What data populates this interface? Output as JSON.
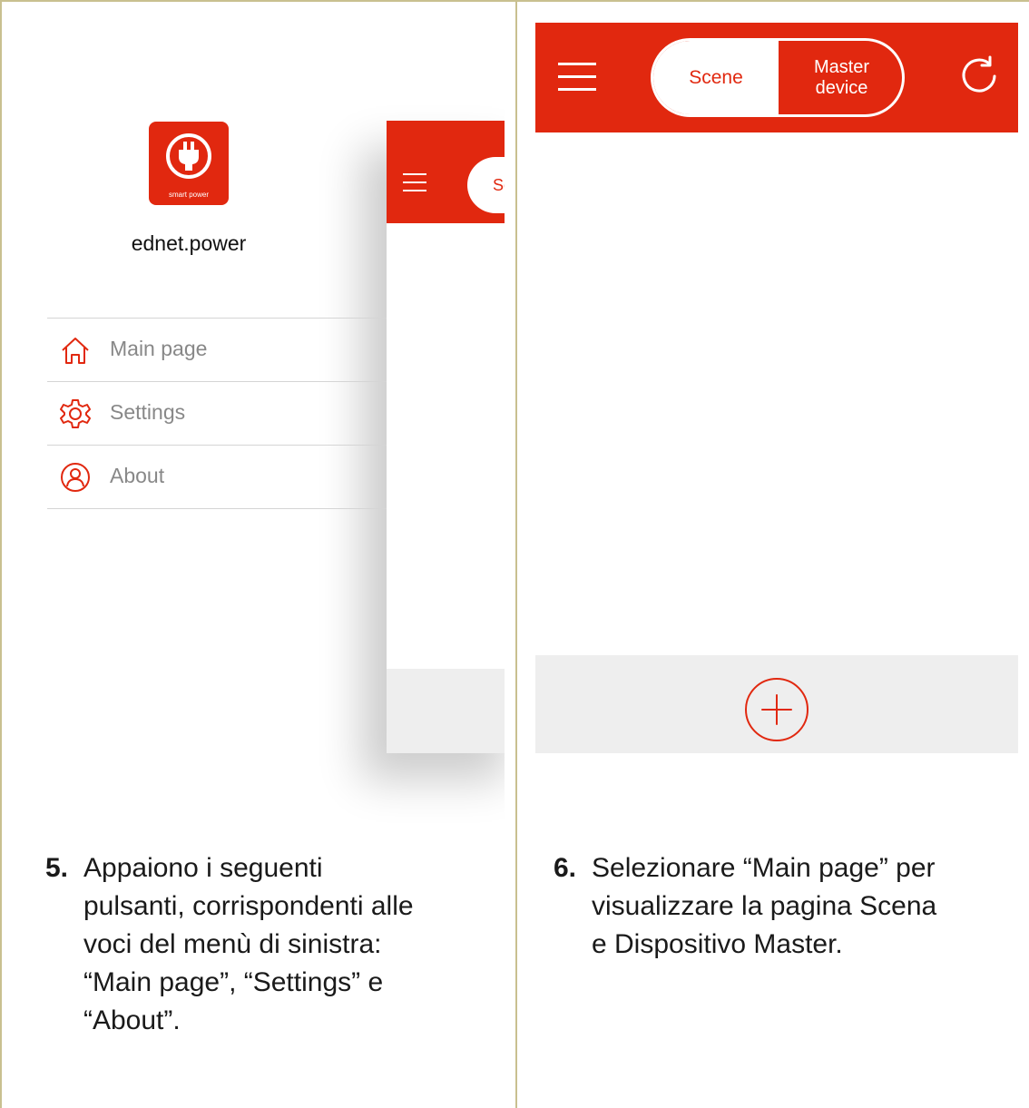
{
  "left_panel": {
    "logo": {
      "icon": "plug-icon",
      "text": "smart power"
    },
    "app_name": "ednet.power",
    "menu": [
      {
        "icon": "home-icon",
        "label": "Main page"
      },
      {
        "icon": "gear-icon",
        "label": "Settings"
      },
      {
        "icon": "user-icon",
        "label": "About"
      }
    ],
    "background_app": {
      "tab_partial": "Sc"
    }
  },
  "right_panel": {
    "toolbar": {
      "menu_icon": "hamburger-icon",
      "tabs": [
        {
          "label": "Scene",
          "selected": true
        },
        {
          "label": "Master\ndevice",
          "selected": false
        }
      ],
      "refresh_icon": "refresh-icon"
    },
    "footer": {
      "add_icon": "plus-circle-icon"
    }
  },
  "captions": [
    {
      "number": "5.",
      "lines": [
        "Appaiono i seguenti",
        "pulsanti, corrispondenti alle",
        "voci del menù di sinistra:",
        "“Main page”, “Settings” e",
        "“About”."
      ]
    },
    {
      "number": "6.",
      "lines": [
        "Selezionare “Main page” per",
        "visualizzare la pagina Scena",
        "e Dispositivo Master."
      ]
    }
  ],
  "colors": {
    "accent": "#e1280f",
    "footer_bg": "#eeeeee",
    "border": "#c9c090"
  }
}
